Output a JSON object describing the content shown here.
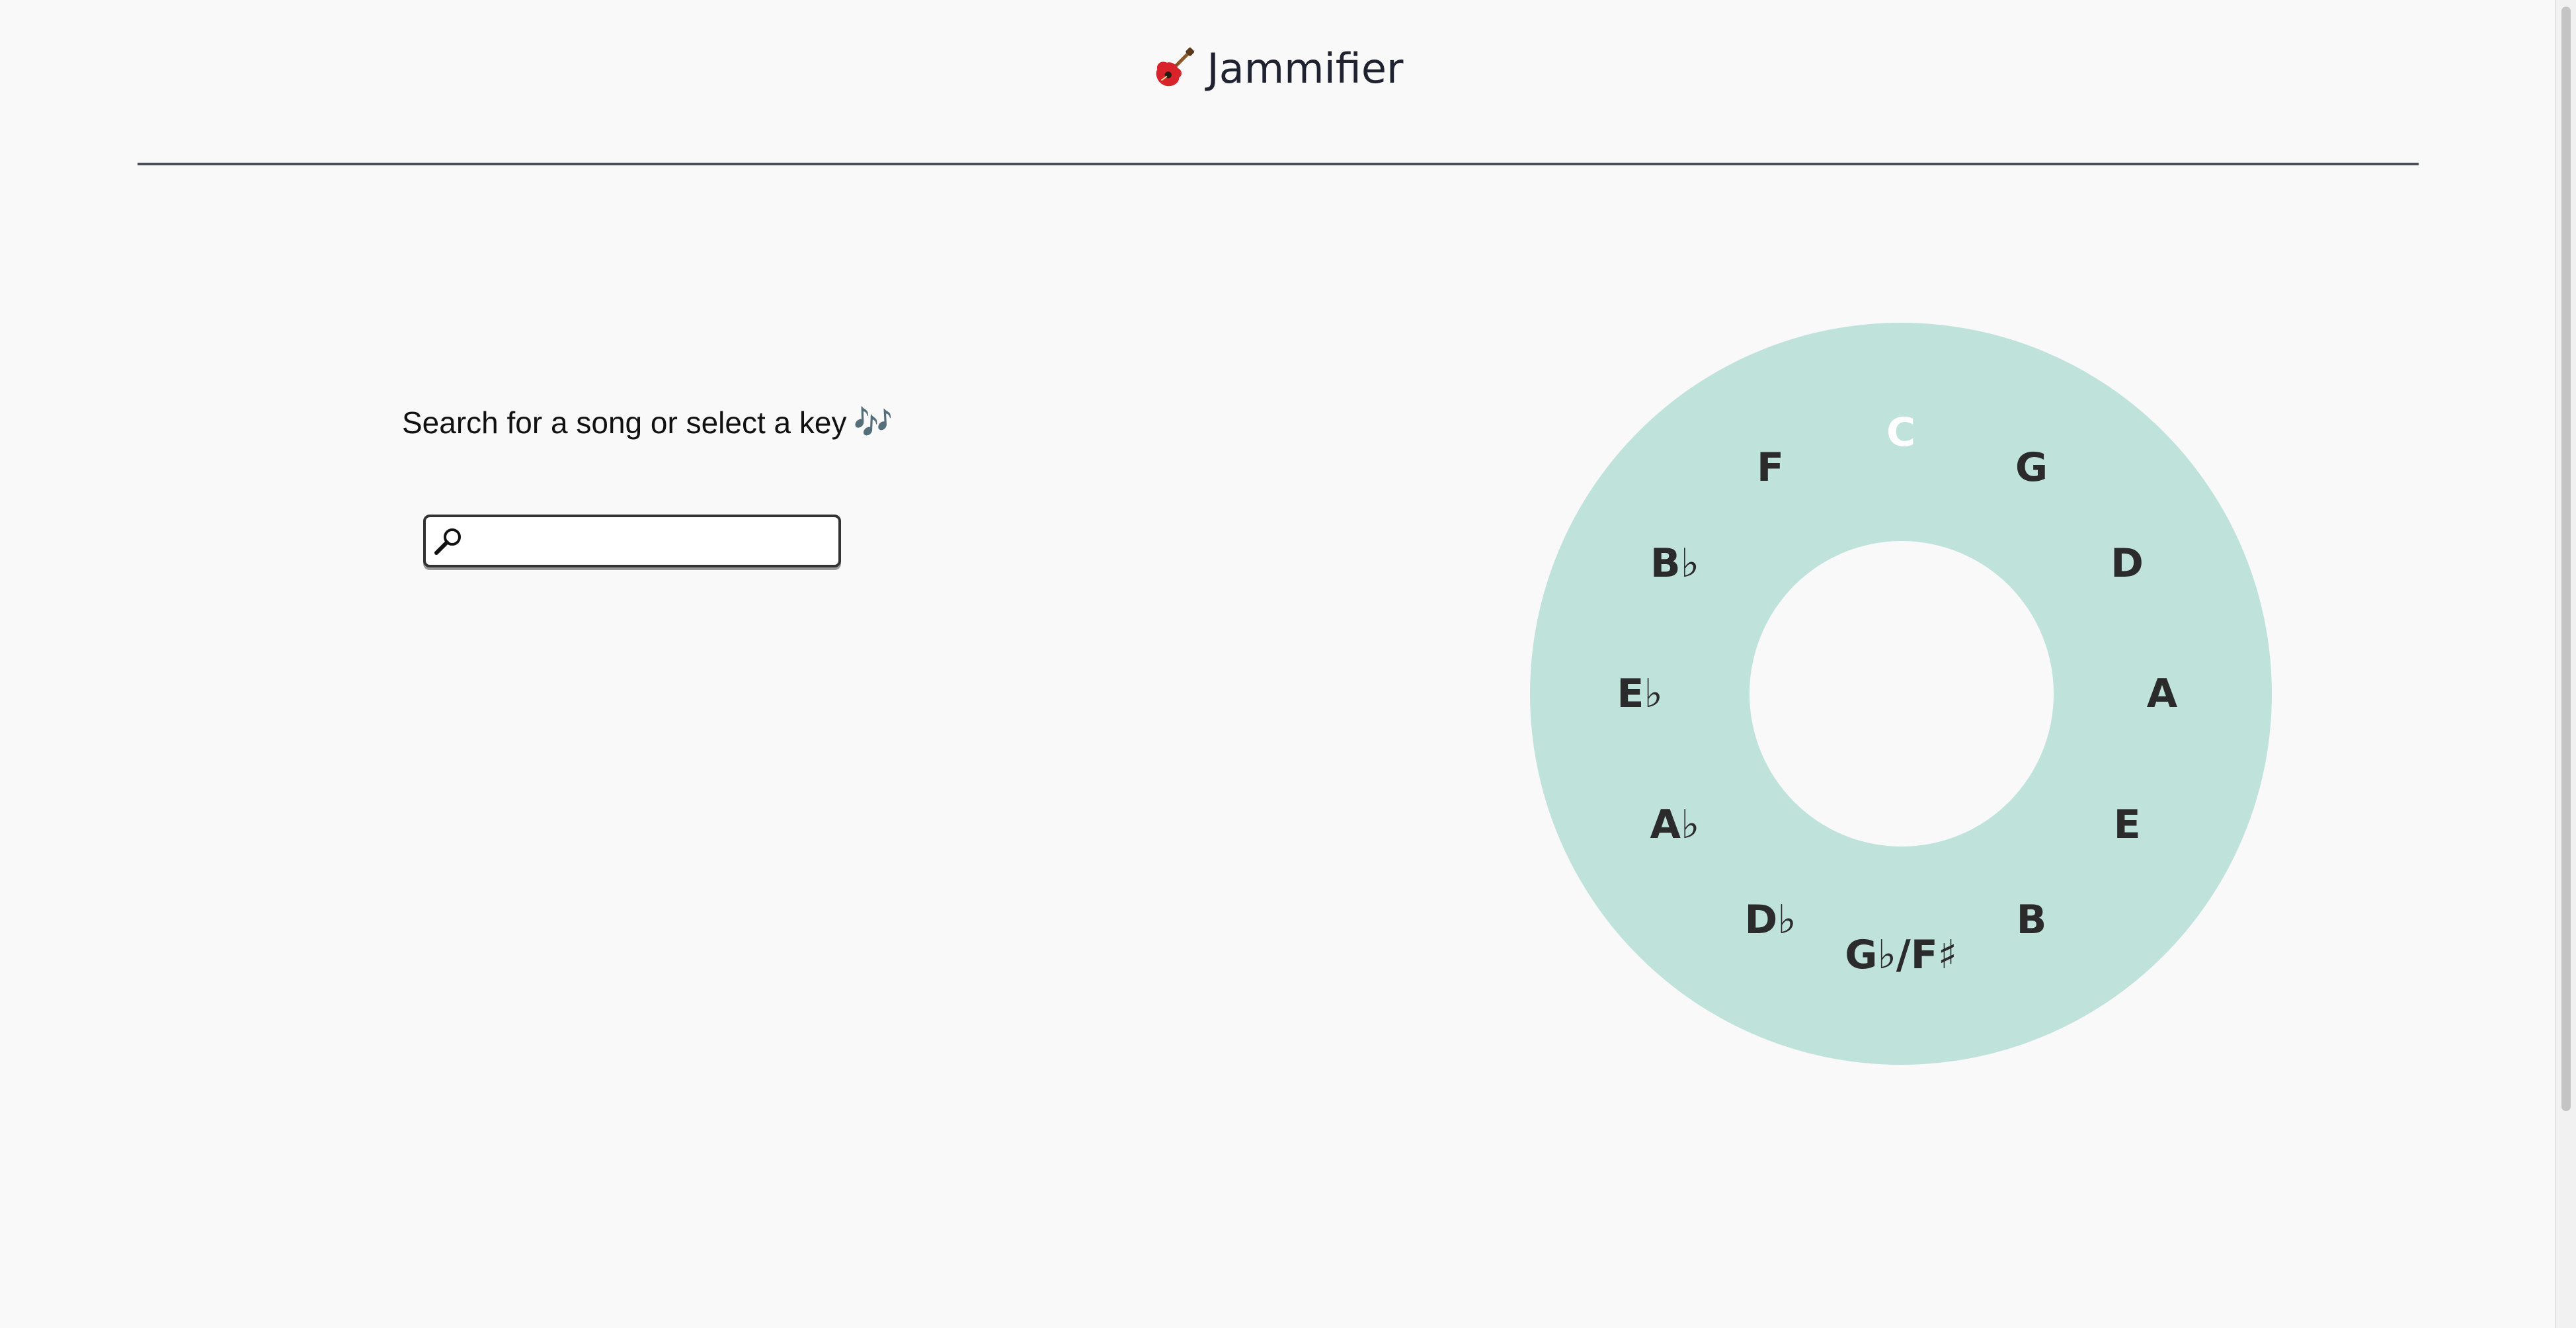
{
  "header": {
    "title": "Jammifier",
    "icon": "guitar-icon"
  },
  "search": {
    "prompt": "Search for a song or select a key",
    "prompt_icon": "music-notes-icon",
    "prompt_glyph": "🎶",
    "input_value": "",
    "placeholder": ""
  },
  "circle_of_fifths": {
    "selected_key": "C",
    "keys": [
      {
        "label": "C",
        "selected": true
      },
      {
        "label": "G",
        "selected": false
      },
      {
        "label": "D",
        "selected": false
      },
      {
        "label": "A",
        "selected": false
      },
      {
        "label": "E",
        "selected": false
      },
      {
        "label": "B",
        "selected": false
      },
      {
        "label": "G♭/F♯",
        "selected": false
      },
      {
        "label": "D♭",
        "selected": false
      },
      {
        "label": "A♭",
        "selected": false
      },
      {
        "label": "E♭",
        "selected": false
      },
      {
        "label": "B♭",
        "selected": false
      },
      {
        "label": "F",
        "selected": false
      }
    ]
  },
  "colors": {
    "background": "#f9f9f9",
    "wheel": "#bfe3db",
    "selected_key": "#ffffff",
    "key_text": "#2b2b2b"
  }
}
